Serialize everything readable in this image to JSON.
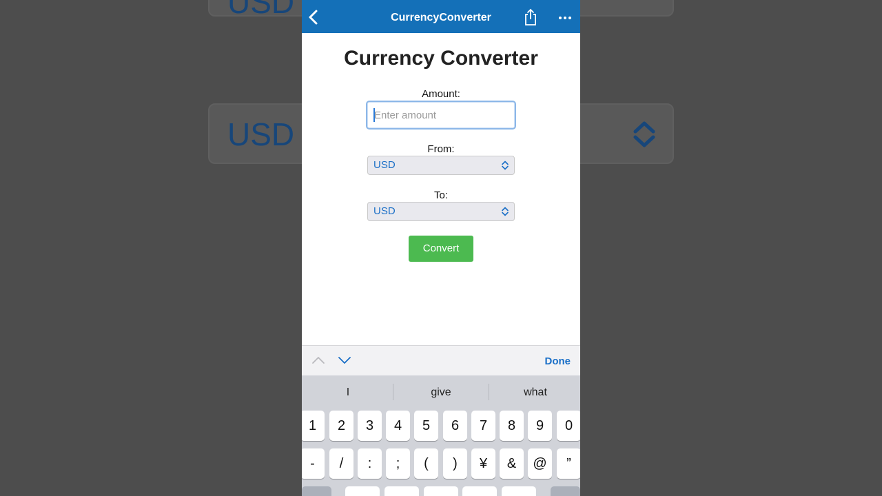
{
  "background": {
    "top_text": "USD",
    "mid_text": "USD"
  },
  "navbar": {
    "title": "CurrencyConverter",
    "back_icon": "chevron-left-icon",
    "share_icon": "share-icon",
    "more_icon": "ellipsis-icon",
    "color": "#1470b8"
  },
  "page": {
    "title": "Currency Converter"
  },
  "form": {
    "amount_label": "Amount:",
    "amount_placeholder": "Enter amount",
    "amount_value": "",
    "from_label": "From:",
    "from_value": "USD",
    "to_label": "To:",
    "to_value": "USD",
    "convert_label": "Convert",
    "convert_color": "#4cba50"
  },
  "accessory": {
    "done_label": "Done"
  },
  "keyboard": {
    "suggestions": [
      "I",
      "give",
      "what"
    ],
    "row1": [
      "1",
      "2",
      "3",
      "4",
      "5",
      "6",
      "7",
      "8",
      "9",
      "0"
    ],
    "row2": [
      "-",
      "/",
      ":",
      ";",
      "(",
      ")",
      "¥",
      "&",
      "@",
      "”"
    ]
  }
}
